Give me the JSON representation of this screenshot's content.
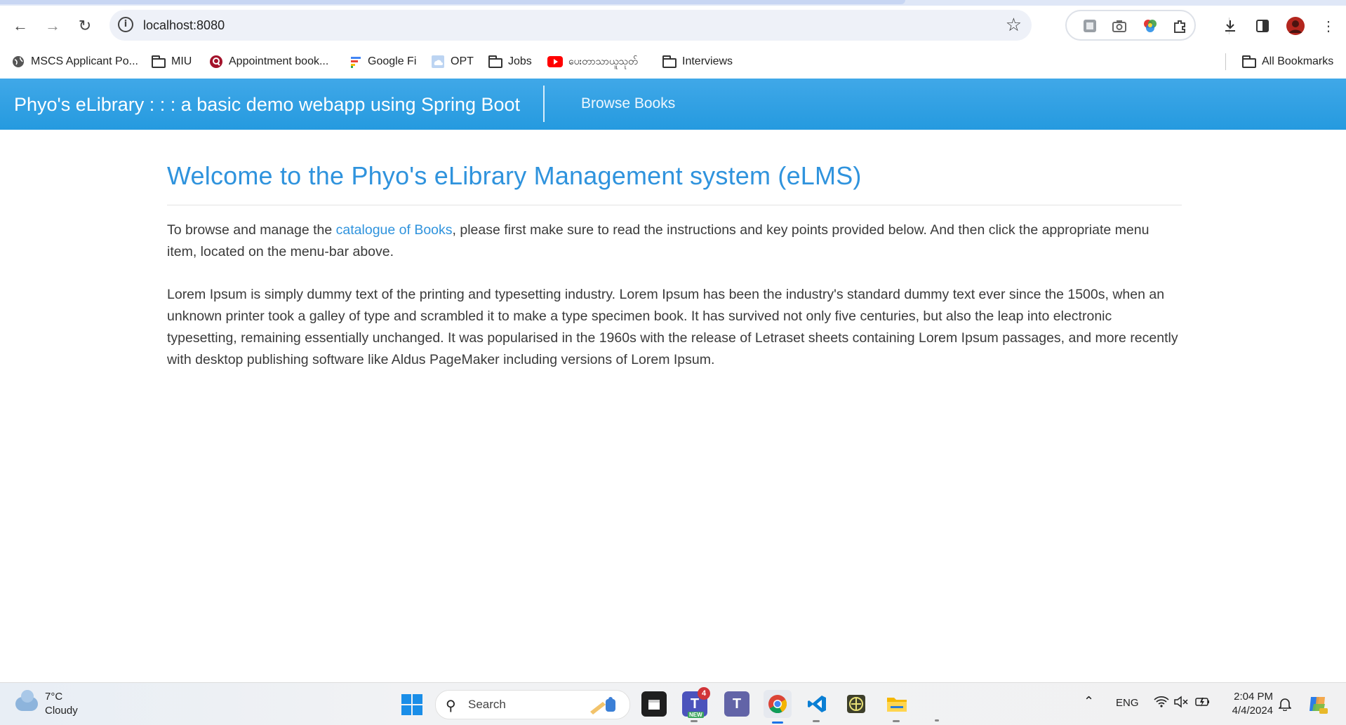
{
  "browser": {
    "url": "localhost:8080",
    "bookmarks": [
      {
        "label": "MSCS Applicant Po...",
        "icon": "globe-icon"
      },
      {
        "label": "MIU",
        "icon": "folder-icon"
      },
      {
        "label": "Appointment book...",
        "icon": "appointment-icon"
      },
      {
        "label": "Google Fi",
        "icon": "google-fi-icon"
      },
      {
        "label": "OPT",
        "icon": "cloud-doc-icon"
      },
      {
        "label": "Jobs",
        "icon": "folder-icon"
      },
      {
        "label": "ပေးတာသာယူသုတ်",
        "icon": "youtube-icon"
      },
      {
        "label": "Interviews",
        "icon": "folder-icon"
      }
    ],
    "all_bookmarks": "All Bookmarks"
  },
  "navbar": {
    "brand": "Phyo's eLibrary : : : a basic demo webapp using Spring Boot",
    "browse_books": "Browse Books",
    "color": "#2b9de2"
  },
  "main": {
    "title": "Welcome to the Phyo's eLibrary Management system (eLMS)",
    "intro_before": "To browse and manage the ",
    "intro_link": "catalogue of Books",
    "intro_after": ", please first make sure to read the instructions and key points provided below. And then click the appropriate menu item, located on the menu-bar above.",
    "lorem": "Lorem Ipsum is simply dummy text of the printing and typesetting industry. Lorem Ipsum has been the industry's standard dummy text ever since the 1500s, when an unknown printer took a galley of type and scrambled it to make a type specimen book. It has survived not only five centuries, but also the leap into electronic typesetting, remaining essentially unchanged. It was popularised in the 1960s with the release of Letraset sheets containing Lorem Ipsum passages, and more recently with desktop publishing software like Aldus PageMaker including versions of Lorem Ipsum.",
    "accent": "#2f93dd"
  },
  "taskbar": {
    "weather_temp": "7°C",
    "weather_desc": "Cloudy",
    "search_placeholder": "Search",
    "teams_badge": "4",
    "teams_new": "NEW",
    "lang": "ENG",
    "time": "2:04 PM",
    "date": "4/4/2024"
  }
}
